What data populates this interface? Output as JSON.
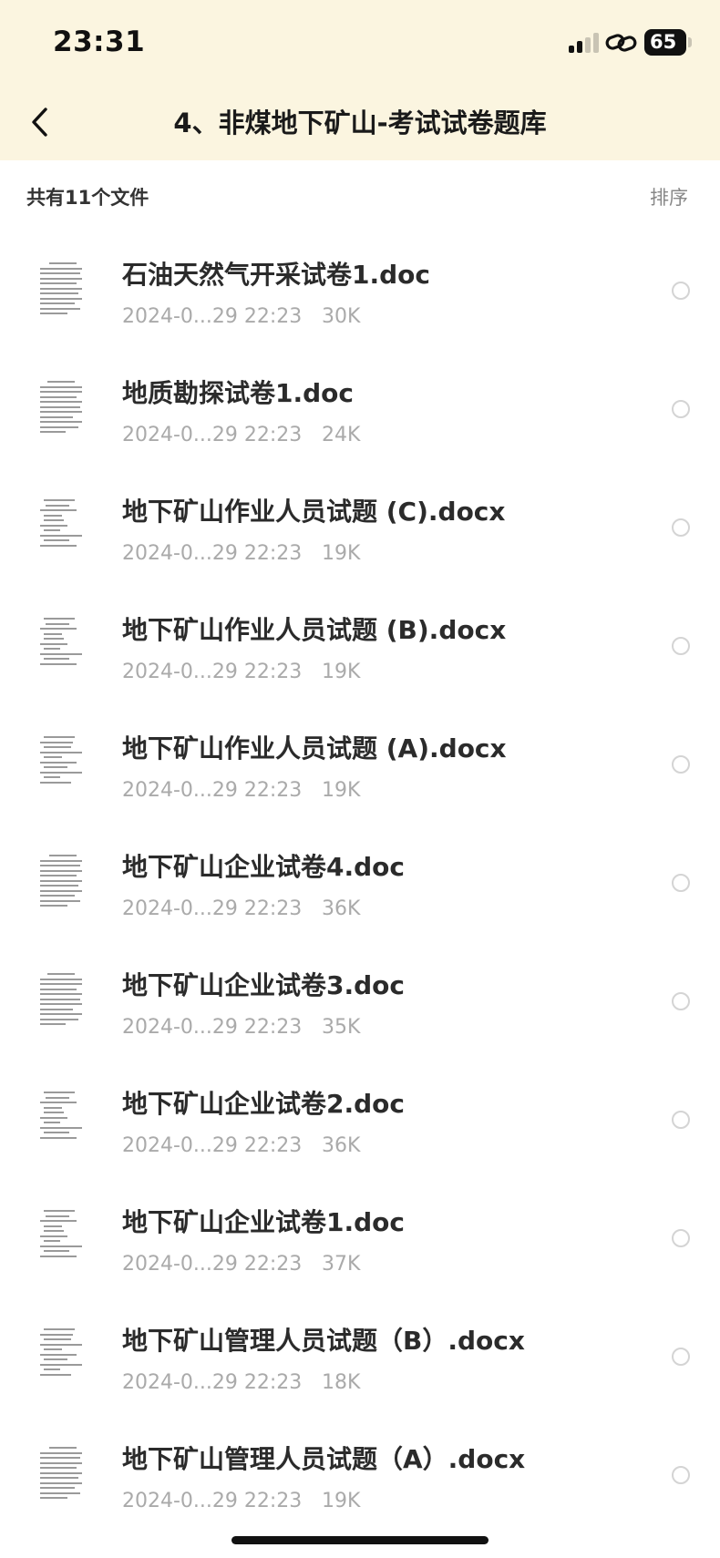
{
  "status_bar": {
    "time": "23:31",
    "battery": "65"
  },
  "header": {
    "title": "4、非煤地下矿山-考试试卷题库"
  },
  "toolbar": {
    "count_label": "共有11个文件",
    "sort_label": "排序"
  },
  "files": [
    {
      "name": "石油天然气开采试卷1.doc",
      "date": "2024-0...29 22:23",
      "size": "30K"
    },
    {
      "name": "地质勘探试卷1.doc",
      "date": "2024-0...29 22:23",
      "size": "24K"
    },
    {
      "name": "地下矿山作业人员试题 (C).docx",
      "date": "2024-0...29 22:23",
      "size": "19K"
    },
    {
      "name": "地下矿山作业人员试题 (B).docx",
      "date": "2024-0...29 22:23",
      "size": "19K"
    },
    {
      "name": "地下矿山作业人员试题 (A).docx",
      "date": "2024-0...29 22:23",
      "size": "19K"
    },
    {
      "name": "地下矿山企业试卷4.doc",
      "date": "2024-0...29 22:23",
      "size": "36K"
    },
    {
      "name": "地下矿山企业试卷3.doc",
      "date": "2024-0...29 22:23",
      "size": "35K"
    },
    {
      "name": "地下矿山企业试卷2.doc",
      "date": "2024-0...29 22:23",
      "size": "36K"
    },
    {
      "name": "地下矿山企业试卷1.doc",
      "date": "2024-0...29 22:23",
      "size": "37K"
    },
    {
      "name": "地下矿山管理人员试题（B）.docx",
      "date": "2024-0...29 22:23",
      "size": "18K"
    },
    {
      "name": "地下矿山管理人员试题（A）.docx",
      "date": "2024-0...29 22:23",
      "size": "19K"
    }
  ],
  "colors": {
    "header_bg": "#fbf5e0",
    "meta_text": "#aaaaaa",
    "radio_border": "#d4d4d4"
  },
  "icons": {
    "back": "chevron-left-icon",
    "link": "link-icon",
    "signal": "signal-icon",
    "battery": "battery-icon",
    "thumbnail": "document-thumbnail-icon",
    "select": "radio-circle-icon"
  }
}
